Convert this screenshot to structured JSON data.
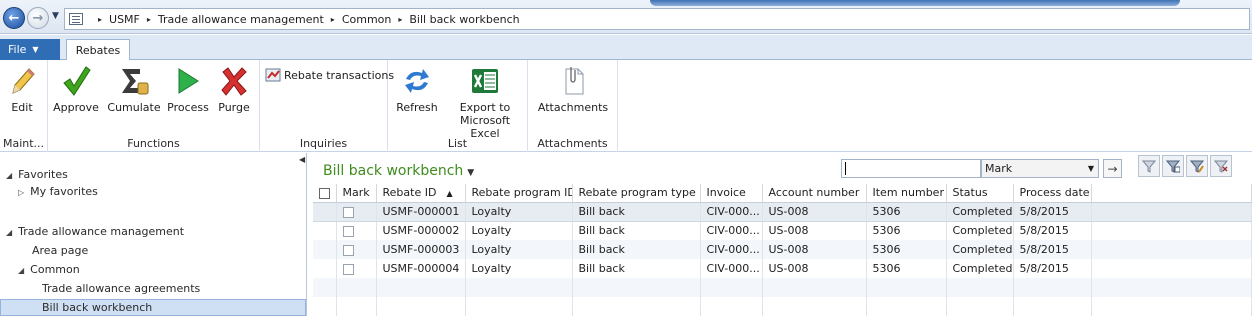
{
  "address": {
    "crumbs": [
      "USMF",
      "Trade allowance management",
      "Common",
      "Bill back workbench"
    ],
    "separator": "▸"
  },
  "tabs": {
    "file": "File",
    "rebates": "Rebates"
  },
  "ribbon": {
    "groups": {
      "maintain": "Maint...",
      "functions": "Functions",
      "inquiries": "Inquiries",
      "list": "List",
      "attachments": "Attachments"
    },
    "buttons": {
      "edit": "Edit",
      "approve": "Approve",
      "cumulate": "Cumulate",
      "process": "Process",
      "purge": "Purge",
      "rebate_transactions": "Rebate transactions",
      "refresh": "Refresh",
      "export_line1": "Export to",
      "export_line2": "Microsoft Excel",
      "attachments": "Attachments"
    }
  },
  "nav": {
    "favorites": "Favorites",
    "my_favorites": "My favorites",
    "module": "Trade allowance management",
    "area_page": "Area page",
    "common": "Common",
    "trade_allowance_agreements": "Trade allowance agreements",
    "bill_back_workbench": "Bill back workbench"
  },
  "grid": {
    "title": "Bill back workbench",
    "filter_value": "",
    "filter_field": "Mark",
    "columns": [
      "Mark",
      "Rebate ID",
      "Rebate program ID",
      "Rebate program type",
      "Invoice",
      "Account number",
      "Item number",
      "Status",
      "Process date"
    ],
    "rows": [
      [
        "",
        "USMF-000001",
        "Loyalty",
        "Bill back",
        "CIV-000...",
        "US-008",
        "5306",
        "Completed",
        "5/8/2015"
      ],
      [
        "",
        "USMF-000002",
        "Loyalty",
        "Bill back",
        "CIV-000...",
        "US-008",
        "5306",
        "Completed",
        "5/8/2015"
      ],
      [
        "",
        "USMF-000003",
        "Loyalty",
        "Bill back",
        "CIV-000...",
        "US-008",
        "5306",
        "Completed",
        "5/8/2015"
      ],
      [
        "",
        "USMF-000004",
        "Loyalty",
        "Bill back",
        "CIV-000...",
        "US-008",
        "5306",
        "Completed",
        "5/8/2015"
      ]
    ]
  },
  "colors": {
    "accent_blue": "#2f6db5",
    "title_green": "#3f8c1f",
    "selection": "#cfe0f4"
  },
  "icons": {
    "back": "back-arrow-icon",
    "forward": "forward-arrow-icon",
    "edit": "pencil-icon",
    "approve": "checkmark-icon",
    "cumulate": "sigma-icon",
    "process": "play-icon",
    "purge": "red-x-icon",
    "refresh": "refresh-icon",
    "export": "excel-icon",
    "attachments": "paperclip-icon"
  }
}
